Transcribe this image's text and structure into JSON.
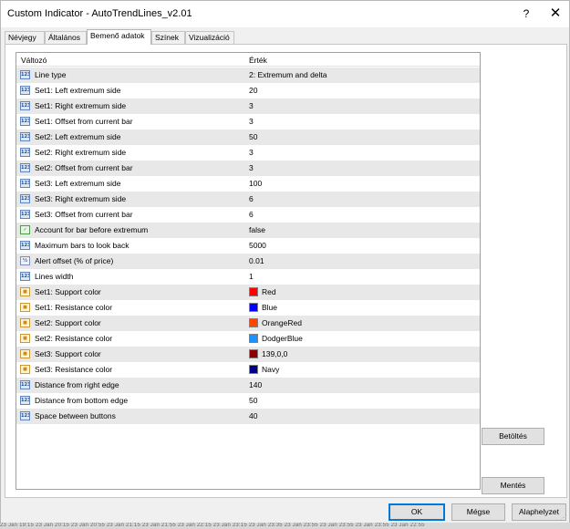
{
  "window": {
    "title": "Custom Indicator - AutoTrendLines_v2.01",
    "help_glyph": "?",
    "close_glyph": "✕"
  },
  "tabs": [
    {
      "label": "Névjegy",
      "active": false
    },
    {
      "label": "Általános",
      "active": false
    },
    {
      "label": "Bemenő adatok",
      "active": true
    },
    {
      "label": "Színek",
      "active": false
    },
    {
      "label": "Vizualizáció",
      "active": false
    }
  ],
  "grid": {
    "col_variable": "Változó",
    "col_value": "Érték",
    "rows": [
      {
        "icon": "int-icon",
        "name": "Line type",
        "value": "2: Extremum and delta"
      },
      {
        "icon": "int-icon",
        "name": "Set1: Left extremum side",
        "value": "20"
      },
      {
        "icon": "int-icon",
        "name": "Set1: Right extremum side",
        "value": "3"
      },
      {
        "icon": "int-icon",
        "name": "Set1: Offset from current bar",
        "value": "3"
      },
      {
        "icon": "int-icon",
        "name": "Set2: Left extremum side",
        "value": "50"
      },
      {
        "icon": "int-icon",
        "name": "Set2: Right extremum side",
        "value": "3"
      },
      {
        "icon": "int-icon",
        "name": "Set2: Offset from current bar",
        "value": "3"
      },
      {
        "icon": "int-icon",
        "name": "Set3: Left extremum side",
        "value": "100"
      },
      {
        "icon": "int-icon",
        "name": "Set3: Right extremum side",
        "value": "6"
      },
      {
        "icon": "int-icon",
        "name": "Set3: Offset from current bar",
        "value": "6"
      },
      {
        "icon": "bool-icon",
        "name": "Account for bar before extremum",
        "value": "false"
      },
      {
        "icon": "int-icon",
        "name": "Maximum bars to look back",
        "value": "5000"
      },
      {
        "icon": "double-icon",
        "name": "Alert offset (% of price)",
        "value": "0.01"
      },
      {
        "icon": "int-icon",
        "name": "Lines width",
        "value": "1"
      },
      {
        "icon": "color-icon",
        "name": "Set1: Support color",
        "value": "Red",
        "swatch": "#ff0000"
      },
      {
        "icon": "color-icon",
        "name": "Set1: Resistance color",
        "value": "Blue",
        "swatch": "#0000ff"
      },
      {
        "icon": "color-icon",
        "name": "Set2: Support color",
        "value": "OrangeRed",
        "swatch": "#ff4500"
      },
      {
        "icon": "color-icon",
        "name": "Set2: Resistance color",
        "value": "DodgerBlue",
        "swatch": "#1e90ff"
      },
      {
        "icon": "color-icon",
        "name": "Set3: Support color",
        "value": "139,0,0",
        "swatch": "#8b0000"
      },
      {
        "icon": "color-icon",
        "name": "Set3: Resistance color",
        "value": "Navy",
        "swatch": "#000080"
      },
      {
        "icon": "int-icon",
        "name": "Distance from right edge",
        "value": "140"
      },
      {
        "icon": "int-icon",
        "name": "Distance from bottom edge",
        "value": "50"
      },
      {
        "icon": "int-icon",
        "name": "Space between buttons",
        "value": "40"
      }
    ]
  },
  "buttons": {
    "load": "Betöltés",
    "save": "Mentés",
    "ok": "OK",
    "cancel": "Mégse",
    "reset": "Alaphelyzet"
  },
  "background_strip": "23 Jan 19:15   23 Jan 20:15   23 Jan 20:55   23 Jan 21:15   23 Jan 21:55   23 Jan 22:15   23 Jan 23:15   23 Jan 23:35   23 Jan 23:55   23 Jan 23:55   23 Jan 23:55   23 Jan 22:55"
}
